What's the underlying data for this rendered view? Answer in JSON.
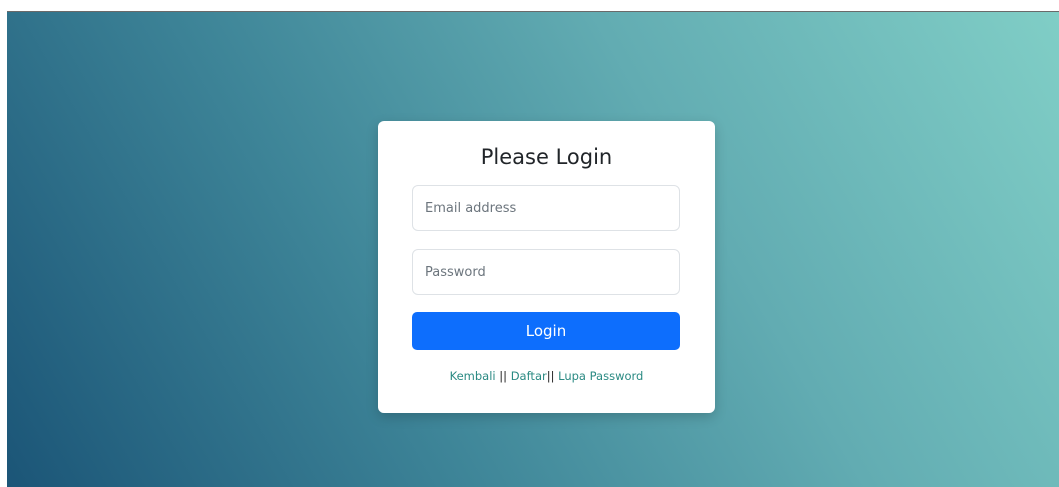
{
  "login": {
    "title": "Please Login",
    "email_placeholder": "Email address",
    "password_placeholder": "Password",
    "button_label": "Login"
  },
  "links": {
    "back": "Kembali",
    "separator": "||",
    "register": "Daftar",
    "forgot": "Lupa Password"
  },
  "colors": {
    "gradient_start": "#1b5577",
    "gradient_end": "#80cec6",
    "primary_button": "#0d6efd",
    "link": "#2a8a83"
  }
}
